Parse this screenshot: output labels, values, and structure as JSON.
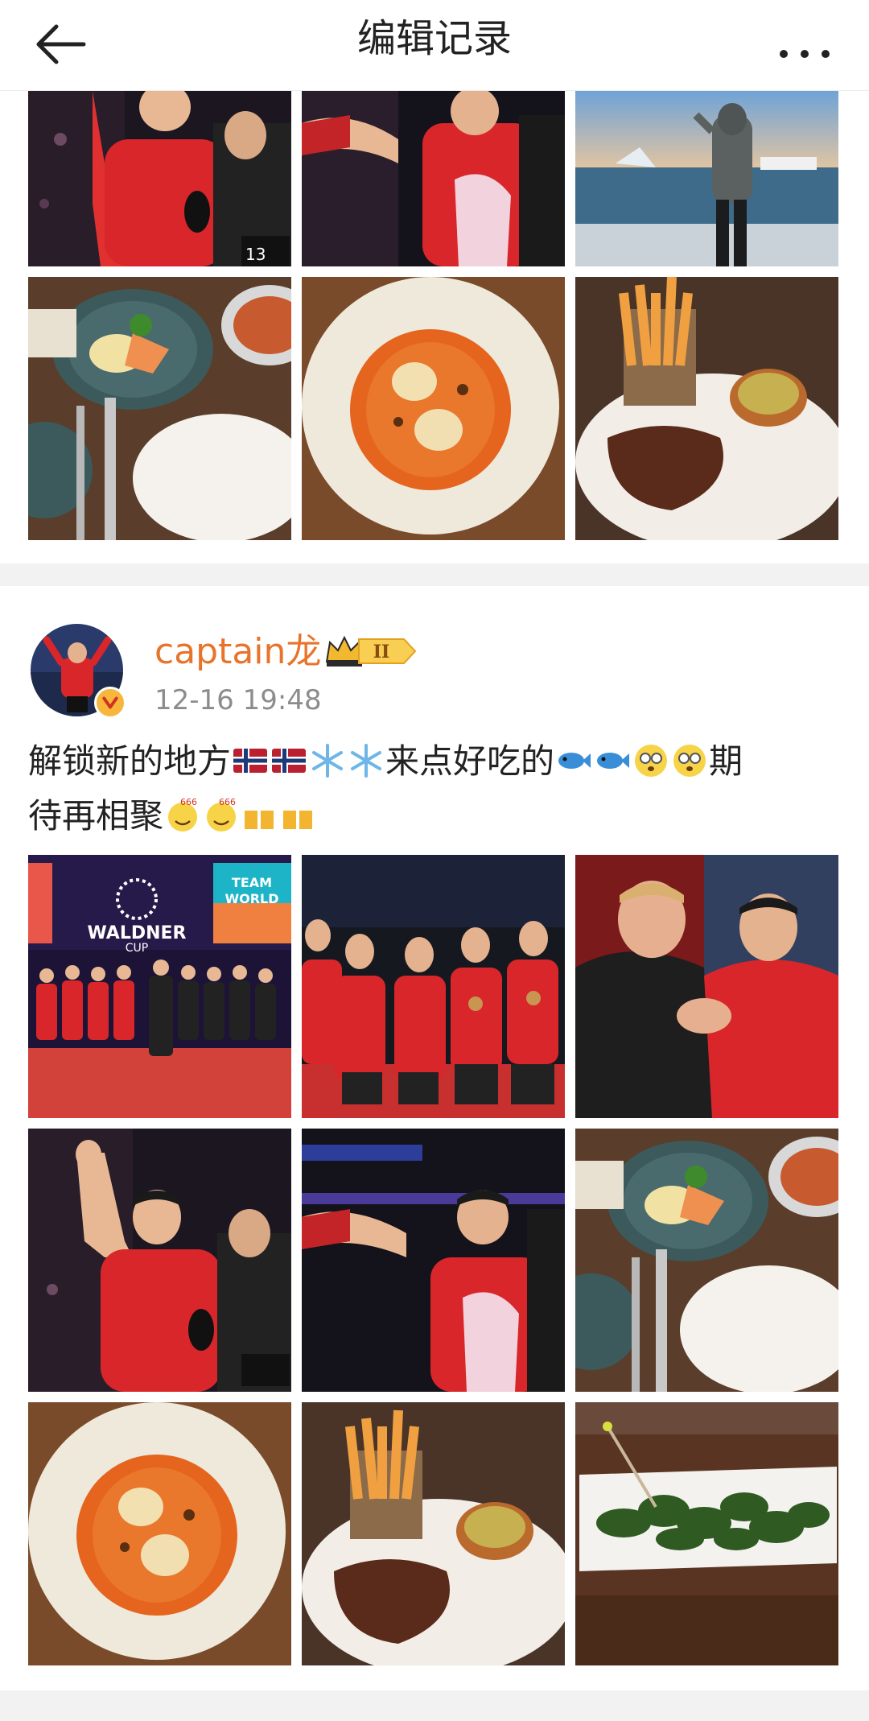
{
  "header": {
    "title": "编辑记录"
  },
  "post": {
    "username": "captain龙",
    "badge_level": "II",
    "timestamp": "12-16 19:48",
    "text_a": "解锁新的地方",
    "text_b": "来点好吃的",
    "text_c": "期",
    "text_d": "待再相聚"
  },
  "images": {
    "waldner_logo": "WALDNER",
    "waldner_sub": "CUP",
    "team_world": "TEAM",
    "team_world2": "WORLD",
    "jersey_number": "13"
  },
  "colors": {
    "accent_orange": "#e8742c",
    "gray_text": "#8c8c8c",
    "separator": "#f2f2f2"
  },
  "icons": [
    "back-arrow-icon",
    "more-dots-icon",
    "crown-icon",
    "verified-icon",
    "norway-flag-icon",
    "snowflake-icon",
    "fish-icon",
    "dizzy-face-icon",
    "smiling-face-icon",
    "beer-icon"
  ]
}
